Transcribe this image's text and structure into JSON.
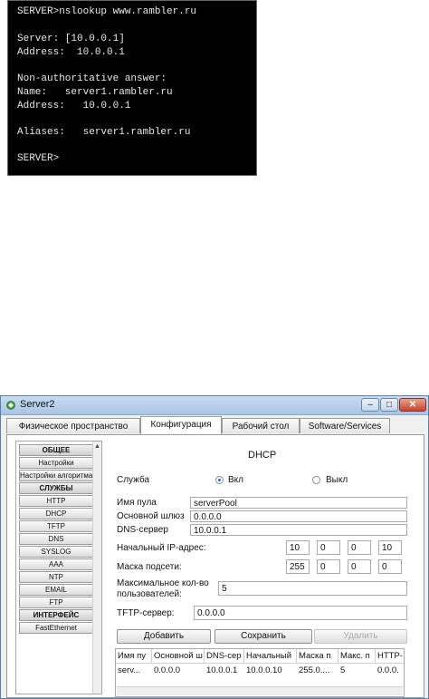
{
  "terminal": {
    "lines": [
      "SERVER>nslookup www.rambler.ru",
      "Server: [10.0.0.1]",
      "Address:  10.0.0.1",
      "Non-authoritative answer:",
      "Name:   server1.rambler.ru",
      "Address:   10.0.0.1",
      "Aliases:   server1.rambler.ru",
      "SERVER>"
    ]
  },
  "window": {
    "title": "Server2",
    "controls": {
      "minimize": "–",
      "maximize": "□",
      "close": "✕"
    },
    "tabs": [
      "Физическое пространство",
      "Конфигурация",
      "Рабочий стол",
      "Software/Services"
    ],
    "active_tab": "Конфигурация"
  },
  "sidebar": {
    "items": [
      {
        "label": "ОБЩЕЕ",
        "header": true
      },
      {
        "label": "Настройки",
        "header": false
      },
      {
        "label": "Настройки алгоритма",
        "header": false
      },
      {
        "label": "СЛУЖБЫ",
        "header": true
      },
      {
        "label": "HTTP",
        "header": false
      },
      {
        "label": "DHCP",
        "header": false
      },
      {
        "label": "TFTP",
        "header": false
      },
      {
        "label": "DNS",
        "header": false
      },
      {
        "label": "SYSLOG",
        "header": false
      },
      {
        "label": "AAA",
        "header": false
      },
      {
        "label": "NTP",
        "header": false
      },
      {
        "label": "EMAIL",
        "header": false
      },
      {
        "label": "FTP",
        "header": false
      },
      {
        "label": "ИНТЕРФЕЙС",
        "header": true
      },
      {
        "label": "FastEthernet",
        "header": false
      }
    ]
  },
  "dhcp": {
    "heading": "DHCP",
    "service_label": "Служба",
    "on_label": "Вкл",
    "off_label": "Выкл",
    "service_state": "on",
    "pool_name_label": "Имя пула",
    "pool_name": "serverPool",
    "gateway_label": "Основной шлюз",
    "gateway": "0.0.0.0",
    "dns_label": "DNS-сервер",
    "dns": "10.0.0.1",
    "start_ip_label": "Начальный IP-адрес:",
    "start_ip": [
      "10",
      "0",
      "0",
      "10"
    ],
    "mask_label": "Маска подсети:",
    "mask": [
      "255",
      "0",
      "0",
      "0"
    ],
    "max_users_label_1": "Максимальное кол-во",
    "max_users_label_2": "пользователей:",
    "max_users": "5",
    "tftp_label": "TFTP-сервер:",
    "tftp": "0.0.0.0",
    "buttons": {
      "add": "Добавить",
      "save": "Сохранить",
      "delete": "Удалить"
    },
    "table": {
      "headers": [
        "Имя пу",
        "Основной ш",
        "DNS-сер",
        "Начальный",
        "Маска п",
        "Макс. п",
        "HTTP-"
      ],
      "rows": [
        [
          "serv...",
          "0.0.0.0",
          "10.0.0.1",
          "10.0.0.10",
          "255.0....",
          "5",
          "0.0.0."
        ]
      ]
    }
  },
  "colors": {
    "radio_selected": "#2a6ad0",
    "title_bar": "#c9dcf1",
    "close_button": "#c8452d"
  }
}
